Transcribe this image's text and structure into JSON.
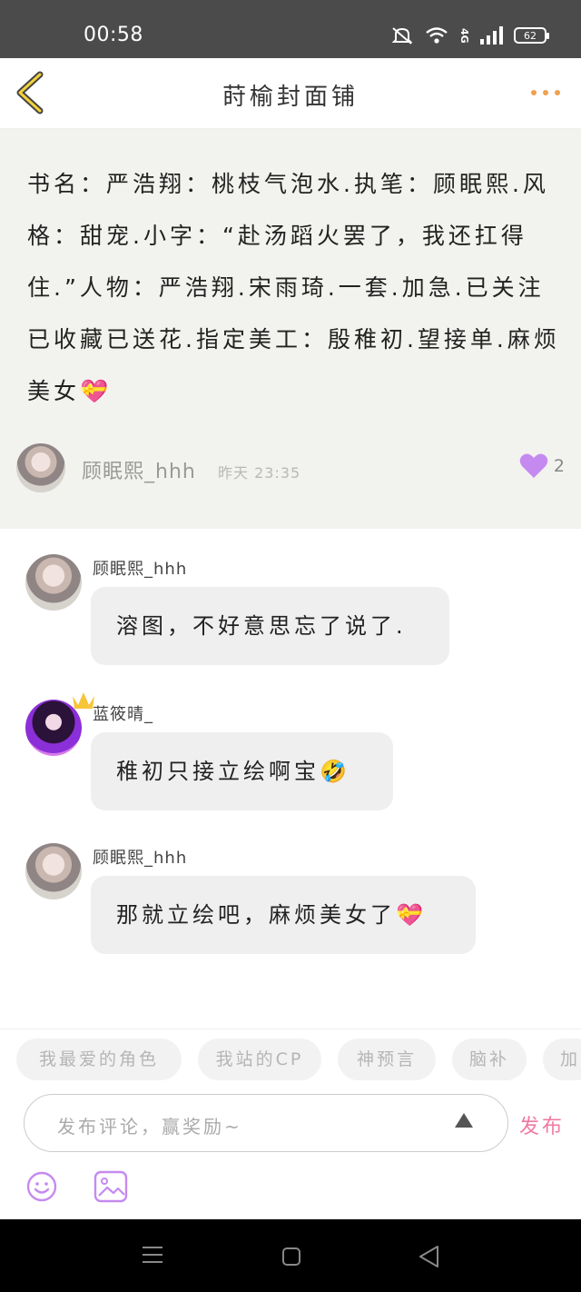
{
  "status_bar": {
    "time": "00:58",
    "battery": "62",
    "network": "4G"
  },
  "header": {
    "title": "莳榆封面铺",
    "back_icon": "chevron-left-icon",
    "more_icon": "more-dots-icon",
    "accent_color": "#f0a050"
  },
  "post": {
    "text": "书名：严浩翔：桃枝气泡水.执笔：顾眠熙.风格：甜宠.小字：“赴汤蹈火罢了，我还扛得住.”人物：严浩翔.宋雨琦.一套.加急.已关注已收藏已送花.指定美工：殷稚初.望接单.麻烦美女💝",
    "author": "顾眠熙_hhh",
    "time": "昨天 23:35",
    "like_count": "2",
    "like_color": "#c58af0"
  },
  "comments": [
    {
      "name": "顾眠熙_hhh",
      "text": "溶图，不好意思忘了说了."
    },
    {
      "name": "蓝筱晴_",
      "text": "稚初只接立绘啊宝🤣"
    },
    {
      "name": "顾眠熙_hhh",
      "text": "那就立绘吧，麻烦美女了💝"
    }
  ],
  "tags": [
    "我最爱的角色",
    "我站的CP",
    "神预言",
    "脑补",
    "加"
  ],
  "input": {
    "placeholder": "发布评论，赢奖励~",
    "publish_label": "发布"
  },
  "colors": {
    "publish": "#f07aa0",
    "toolbar_icons": "#c58af0"
  }
}
